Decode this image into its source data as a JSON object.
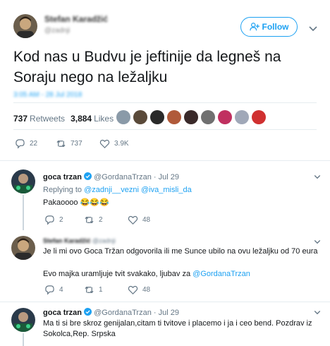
{
  "main_tweet": {
    "author_name": "Stefan Karadžić",
    "author_handle": "@zadnji",
    "follow_label": "Follow",
    "text": "Kod nas u Budvu je jeftinije da legneš na Soraju nego na ležaljku",
    "timestamp": "3:05 AM - 28 Jul 2018",
    "retweets_count": "737",
    "retweets_label": "Retweets",
    "likes_count": "3,884",
    "likes_label": "Likes",
    "actions": {
      "reply": "22",
      "retweet": "737",
      "like": "3.9K"
    }
  },
  "replies": [
    {
      "author_name": "goca trzan",
      "author_handle": "@GordanaTrzan",
      "date": "Jul 29",
      "replying_prefix": "Replying to",
      "replying_to_1": "@zadnji__vezni",
      "replying_to_2": "@iva_misli_da",
      "text": "Pakaoooo 😂😂😂",
      "actions": {
        "reply": "2",
        "retweet": "2",
        "like": "48"
      }
    },
    {
      "author_name": "Stefan Karadžić",
      "author_handle": "@zadnji",
      "text_1": "Je li mi ovo Goca Tržan odgovorila ili me Sunce ubilo na ovu ležaljku od 70 eura",
      "text_2_prefix": "Evo majka uramljuje tvit svakako, ljubav za ",
      "text_2_mention": "@GordanaTrzan",
      "actions": {
        "reply": "4",
        "retweet": "1",
        "like": "48"
      }
    },
    {
      "author_name": "goca trzan",
      "author_handle": "@GordanaTrzan",
      "date": "Jul 29",
      "text": "Ma ti si bre skroz genijalan,citam ti tvitove i placemo i ja i ceo bend. Pozdrav iz Sokolca,Rep. Srpska"
    }
  ],
  "colors": {
    "accent": "#1da1f2",
    "muted": "#657786",
    "border": "#e6ecf0",
    "verified": "#1da1f2"
  }
}
